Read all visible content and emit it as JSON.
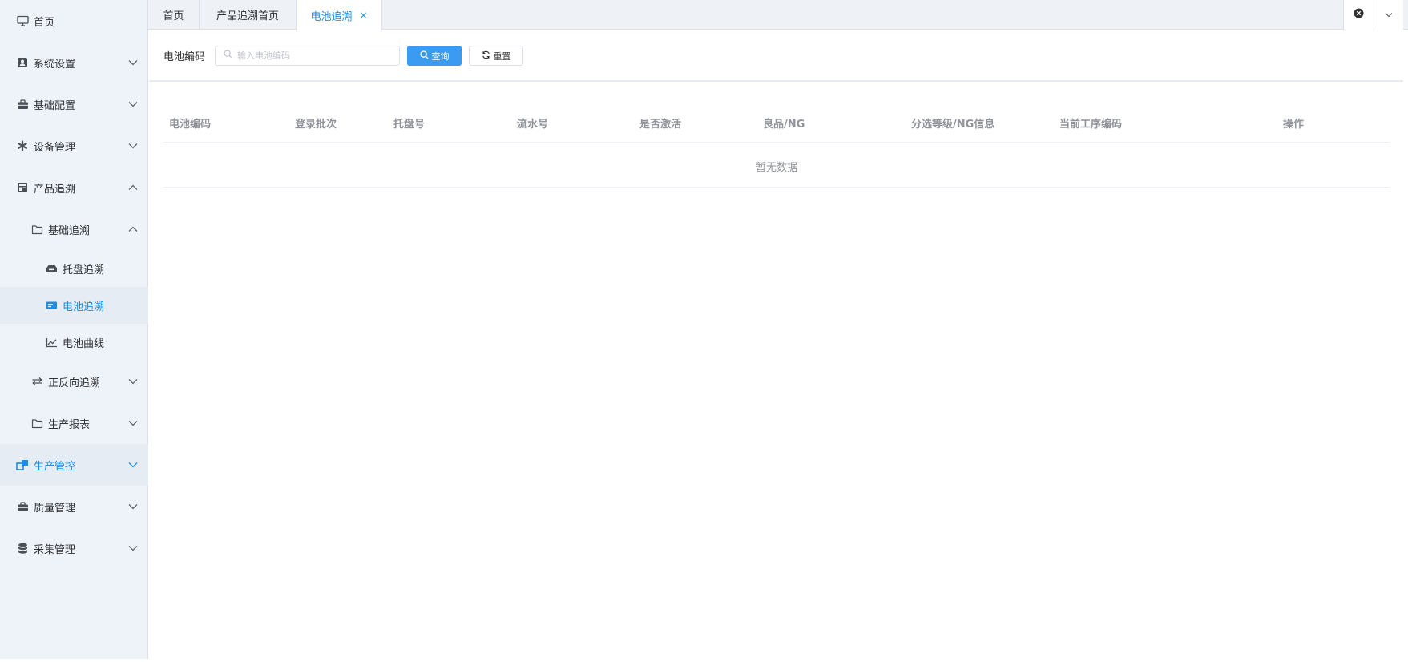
{
  "sidebar": {
    "home": "首页",
    "system_settings": "系统设置",
    "basic_config": "基础配置",
    "device_mgmt": "设备管理",
    "product_trace": "产品追溯",
    "basic_trace": "基础追溯",
    "tray_trace": "托盘追溯",
    "battery_trace": "电池追溯",
    "battery_curve": "电池曲线",
    "fwd_rev_trace": "正反向追溯",
    "production_report": "生产报表",
    "production_control": "生产管控",
    "quality_mgmt": "质量管理",
    "collection_mgmt": "采集管理"
  },
  "tabs": [
    {
      "label": "首页"
    },
    {
      "label": "产品追溯首页"
    },
    {
      "label": "电池追溯",
      "close": "×"
    }
  ],
  "search": {
    "label": "电池编码",
    "placeholder": "输入电池编码",
    "query_button": "查询",
    "reset_button": "重置"
  },
  "table": {
    "columns": [
      "电池编码",
      "登录批次",
      "托盘号",
      "流水号",
      "是否激活",
      "良品/NG",
      "分选等级/NG信息",
      "当前工序编码",
      "操作"
    ],
    "empty_text": "暂无数据"
  },
  "colors": {
    "accent": "#1e8ce4",
    "primary_button": "#3a9bf0",
    "sidebar_bg": "#eef3f9"
  }
}
